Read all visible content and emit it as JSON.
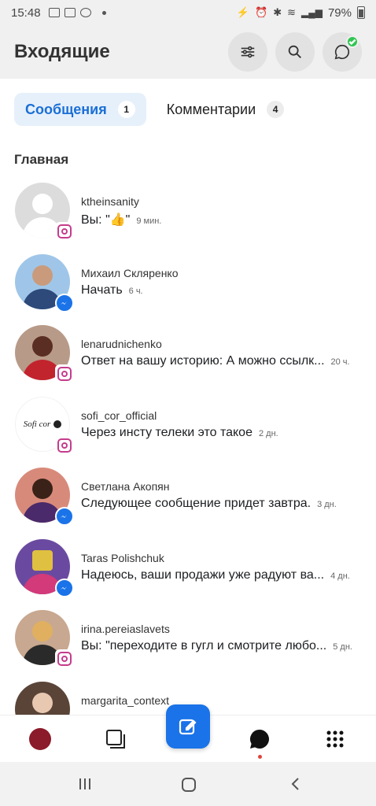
{
  "status_bar": {
    "time": "15:48",
    "battery": "79%"
  },
  "header": {
    "title": "Входящие"
  },
  "tabs": [
    {
      "label": "Сообщения",
      "count": "1"
    },
    {
      "label": "Комментарии",
      "count": "4"
    }
  ],
  "section_title": "Главная",
  "conversations": [
    {
      "name": "ktheinsanity",
      "message": "Вы: \"👍\"",
      "time": "9 мин.",
      "platform": "instagram"
    },
    {
      "name": "Михаил Скляренко",
      "message": "Начать",
      "time": "6 ч.",
      "platform": "messenger"
    },
    {
      "name": "lenarudnichenko",
      "message": "Ответ на вашу историю: А можно ссылк...",
      "time": "20 ч.",
      "platform": "instagram"
    },
    {
      "name": "sofi_cor_official",
      "message": "Через инсту телеки это такое",
      "time": "2 дн.",
      "platform": "instagram",
      "avatar_text": "Sofi cor"
    },
    {
      "name": "Светлана Акопян",
      "message": "Следующее сообщение придет завтра.",
      "time": "3 дн.",
      "platform": "messenger"
    },
    {
      "name": "Taras Polishchuk",
      "message": "Надеюсь, ваши продажи уже радуют ва...",
      "time": "4 дн.",
      "platform": "messenger"
    },
    {
      "name": "irina.pereiaslavets",
      "message": "Вы: \"переходите в гугл и смотрите любо...",
      "time": "5 дн.",
      "platform": "instagram"
    },
    {
      "name": "margarita_context",
      "message": "",
      "time": "",
      "platform": "instagram"
    }
  ],
  "colors": {
    "accent": "#1a73e8",
    "instagram": "#c53c8c",
    "online": "#31c552"
  }
}
